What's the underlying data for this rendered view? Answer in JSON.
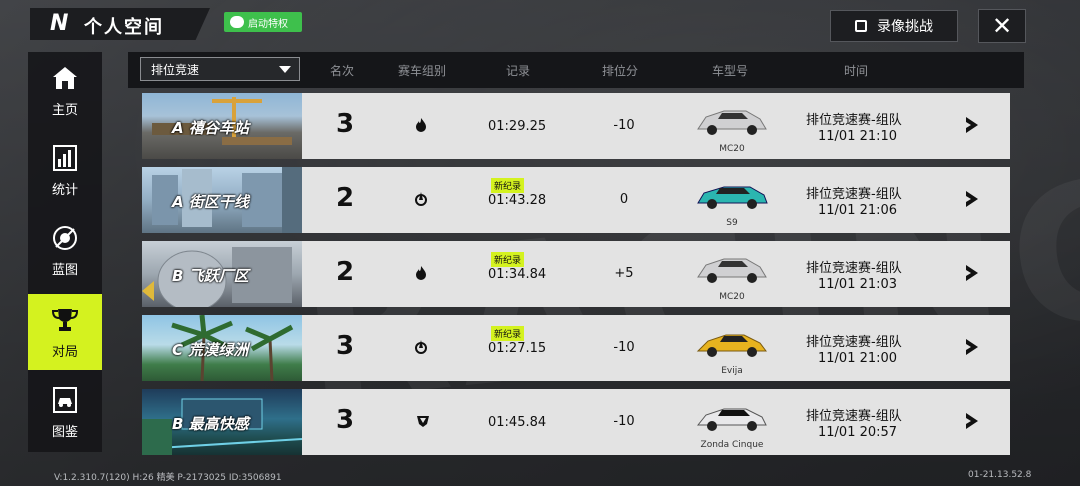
{
  "app": {
    "logo": "N",
    "title": "个人空间"
  },
  "wechat_btn": "启动特权",
  "record_btn": "录像挑战",
  "close_icon": "✕",
  "sidebar": [
    {
      "label": "主页",
      "icon": "home-icon",
      "active": false
    },
    {
      "label": "统计",
      "icon": "stats-icon",
      "active": false
    },
    {
      "label": "蓝图",
      "icon": "blueprint-icon",
      "active": false
    },
    {
      "label": "对局",
      "icon": "trophy-icon",
      "active": true
    },
    {
      "label": "图鉴",
      "icon": "car-gallery-icon",
      "active": false
    }
  ],
  "filter": {
    "selected": "排位竞速"
  },
  "columns": [
    "名次",
    "赛车组别",
    "记录",
    "排位分",
    "车型号",
    "时间"
  ],
  "new_record_label": "新纪录",
  "rows": [
    {
      "track": "A 禧谷车站",
      "rank": "3",
      "group_icon": "flame-icon",
      "record": "01:29.25",
      "new": false,
      "score": "-10",
      "car": "MC20",
      "mode": "排位竞速赛-组队",
      "time": "11/01  21:10"
    },
    {
      "track": "A 街区干线",
      "rank": "2",
      "group_icon": "swirl-icon",
      "record": "01:43.28",
      "new": true,
      "score": "0",
      "car": "S9",
      "mode": "排位竞速赛-组队",
      "time": "11/01  21:06"
    },
    {
      "track": "B 飞跃厂区",
      "rank": "2",
      "group_icon": "flame-icon",
      "record": "01:34.84",
      "new": true,
      "score": "+5",
      "car": "MC20",
      "mode": "排位竞速赛-组队",
      "time": "11/01  21:03"
    },
    {
      "track": "C 荒漠绿洲",
      "rank": "3",
      "group_icon": "swirl-icon",
      "record": "01:27.15",
      "new": true,
      "score": "-10",
      "car": "Evija",
      "mode": "排位竞速赛-组队",
      "time": "11/01  21:00"
    },
    {
      "track": "B 最高快感",
      "rank": "3",
      "group_icon": "crest-icon",
      "record": "01:45.84",
      "new": false,
      "score": "-10",
      "car": "Zonda Cinque",
      "mode": "排位竞速赛-组队",
      "time": "11/01  20:57"
    }
  ],
  "footer": {
    "left": "V:1.2.310.7(120) H:26 精美 P-2173025 ID:3506891",
    "right": "01-21.13.52.8"
  },
  "colors": {
    "accent": "#d4f21f",
    "wechat": "#3ec04c",
    "row_bg": "#e3e3e3"
  }
}
